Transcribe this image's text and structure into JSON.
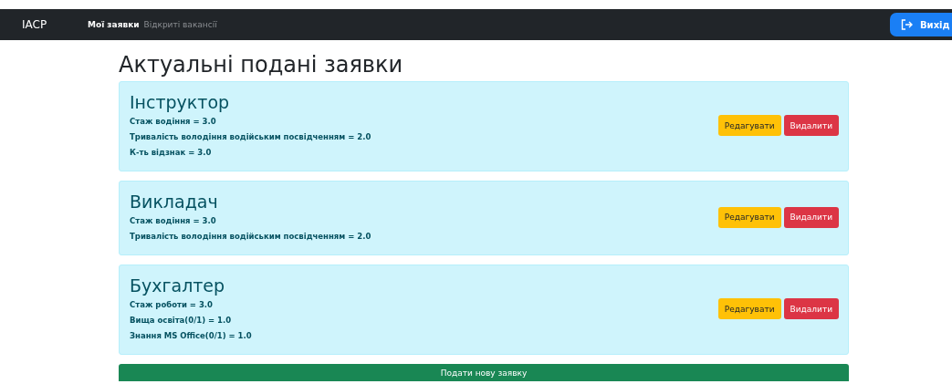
{
  "navbar": {
    "brand": "IACP",
    "links": [
      {
        "label": "Мої заявки",
        "selected": true
      },
      {
        "label": "Відкриті вакансії",
        "selected": false
      }
    ],
    "logout": "Вихід"
  },
  "heading": "Актуальні подані заявки",
  "applications": [
    {
      "title": "Інструктор",
      "criteria": [
        "Стаж водіння = 3.0",
        "Тривалість володіння водійським посвідченням = 2.0",
        "К-ть відзнак = 3.0"
      ],
      "edit": "Редагувати",
      "delete": "Видалити"
    },
    {
      "title": "Викладач",
      "criteria": [
        "Стаж водіння = 3.0",
        "Тривалість володіння водійським посвідченням = 2.0"
      ],
      "edit": "Редагувати",
      "delete": "Видалити"
    },
    {
      "title": "Бухгалтер",
      "criteria": [
        "Стаж роботи = 3.0",
        "Вища освіта(0/1) = 1.0",
        "Знання MS Office(0/1) = 1.0"
      ],
      "edit": "Редагувати",
      "delete": "Видалити"
    }
  ],
  "new_application": "Подати нову заявку"
}
